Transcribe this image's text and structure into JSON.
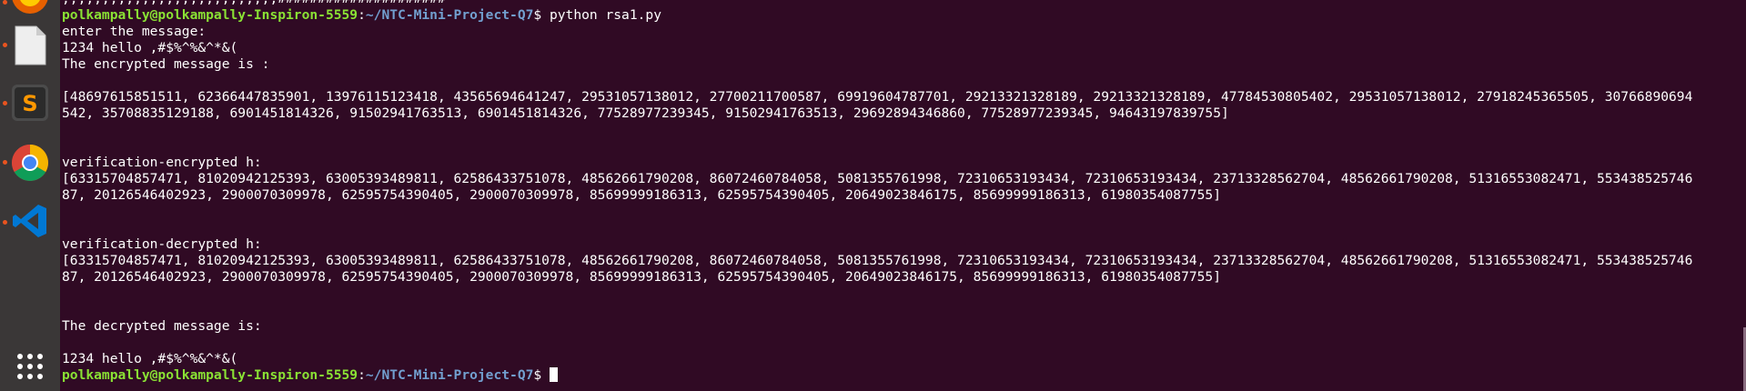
{
  "launcher": {
    "items": [
      {
        "name": "firefox-icon"
      },
      {
        "name": "files-icon"
      },
      {
        "name": "sublime-text-icon"
      },
      {
        "name": "chrome-icon"
      },
      {
        "name": "vscode-icon"
      },
      {
        "name": "show-applications-icon"
      }
    ],
    "accent_color": "#e9541f"
  },
  "terminal": {
    "background": "#300a24",
    "prompt_user": "polkampally@polkampally-Inspiron-5559",
    "prompt_path": "~/NTC-Mini-Project-Q7",
    "lines": {
      "l0": ",,,,,,,,,,,,,,,,,,,,,,,,,,,#####################",
      "cmd1": "python rsa1.py",
      "l2": "enter the message:",
      "l3": "1234 hello ,#$%^%&^*&(",
      "l4": "The encrypted message is :",
      "l5": "",
      "l6": "[48697615851511, 62366447835901, 13976115123418, 43565694641247, 29531057138012, 27700211700587, 69919604787701, 29213321328189, 29213321328189, 47784530805402, 29531057138012, 27918245365505, 30766890694",
      "l7": "542, 35708835129188, 6901451814326, 91502941763513, 6901451814326, 77528977239345, 91502941763513, 29692894346860, 77528977239345, 94643197839755]",
      "l8": "",
      "l9": "",
      "l10": "verification-encrypted h:",
      "l11": "[63315704857471, 81020942125393, 63005393489811, 62586433751078, 48562661790208, 86072460784058, 5081355761998, 72310653193434, 72310653193434, 23713328562704, 48562661790208, 51316553082471, 553438525746",
      "l12": "87, 20126546402923, 2900070309978, 62595754390405, 2900070309978, 85699999186313, 62595754390405, 20649023846175, 85699999186313, 61980354087755]",
      "l13": "",
      "l14": "",
      "l15": "verification-decrypted h:",
      "l16": "[63315704857471, 81020942125393, 63005393489811, 62586433751078, 48562661790208, 86072460784058, 5081355761998, 72310653193434, 72310653193434, 23713328562704, 48562661790208, 51316553082471, 553438525746",
      "l17": "87, 20126546402923, 2900070309978, 62595754390405, 2900070309978, 85699999186313, 62595754390405, 20649023846175, 85699999186313, 61980354087755]",
      "l18": "",
      "l19": "",
      "l20": "The decrypted message is:",
      "l21": "",
      "l22": "1234 hello ,#$%^%&^*&("
    }
  }
}
